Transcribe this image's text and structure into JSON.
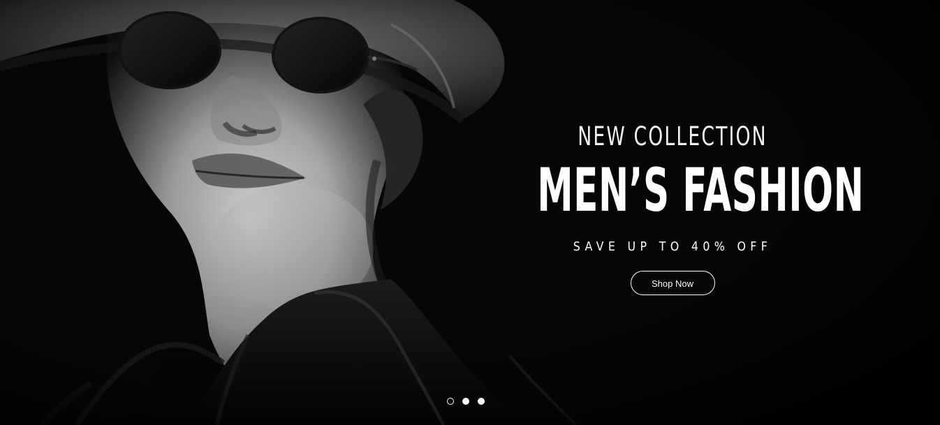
{
  "hero": {
    "eyebrow": "NEW COLLECTION",
    "headline": "MEN’S FASHION",
    "subheadline": "SAVE UP TO 40% OFF",
    "cta_label": "Shop Now"
  },
  "carousel": {
    "current_index": 1,
    "total_slides": 3
  },
  "colors": {
    "background": "#070707",
    "text": "#ffffff"
  }
}
